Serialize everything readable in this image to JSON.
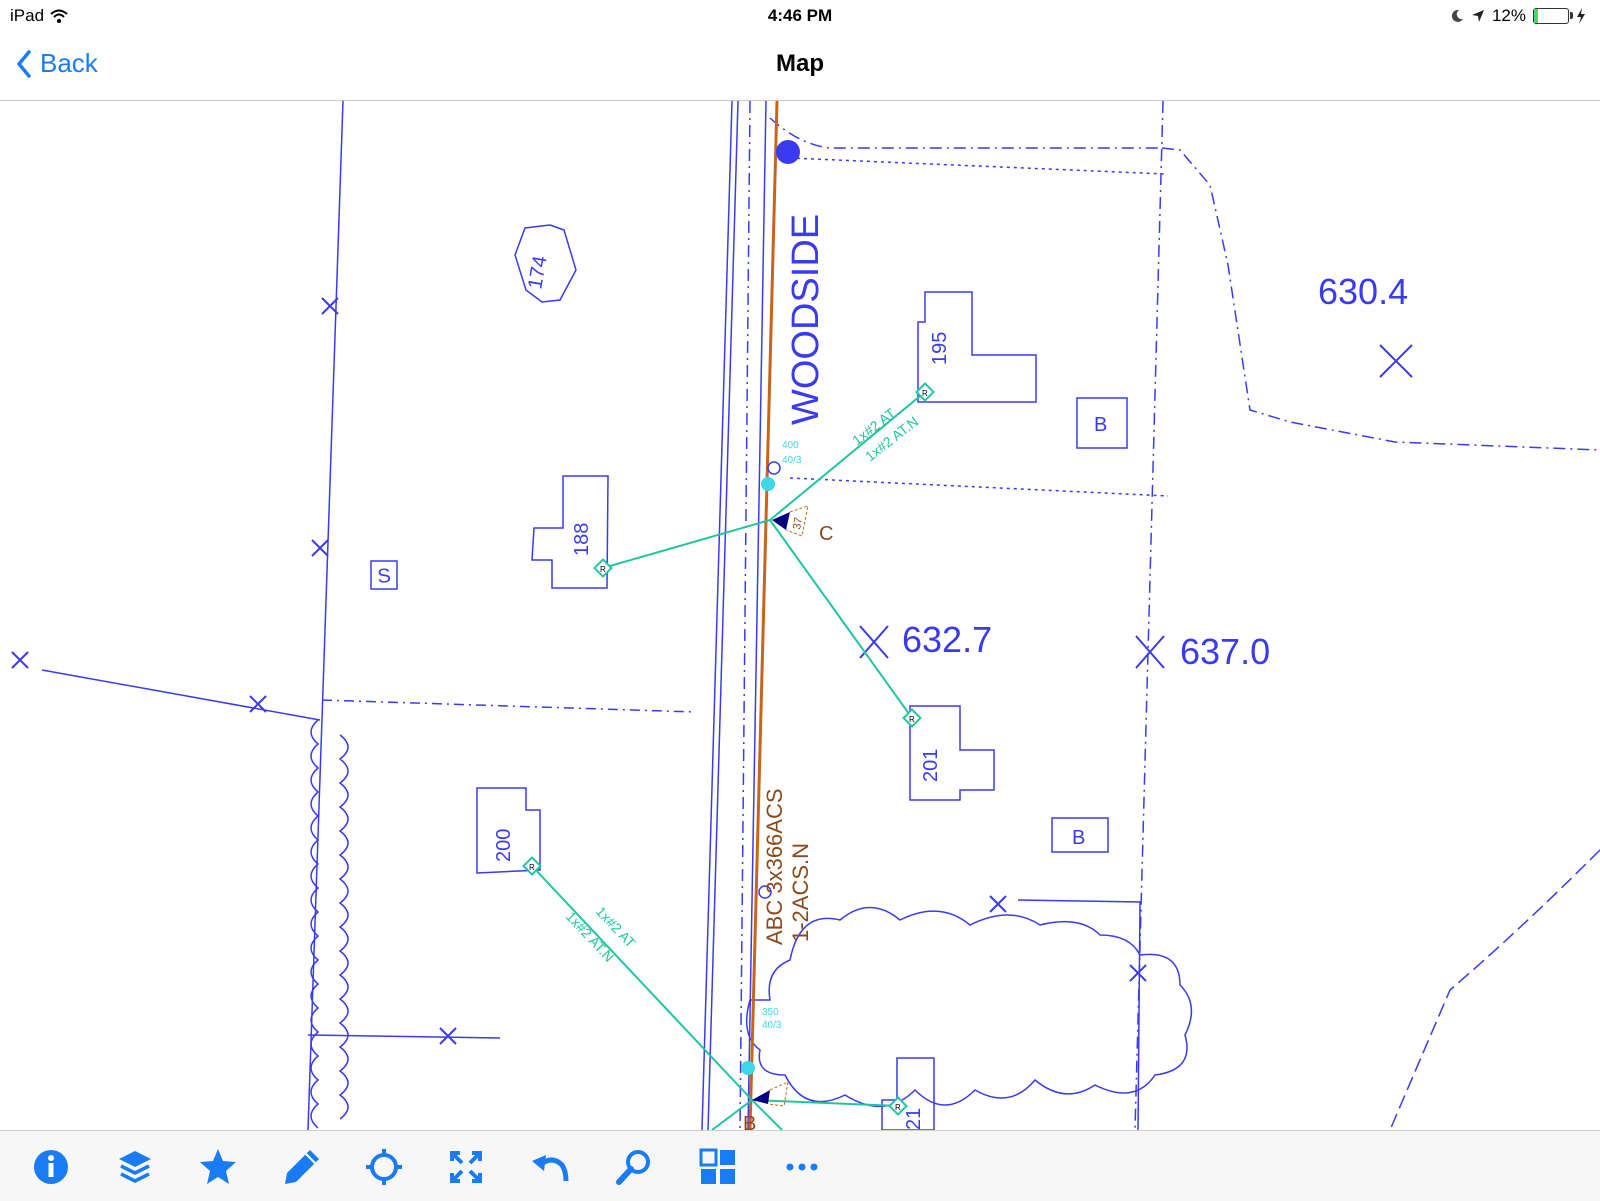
{
  "status_bar": {
    "device": "iPad",
    "time": "4:46 PM",
    "battery": "12%",
    "battery_level": 0.12
  },
  "nav": {
    "back_label": "Back",
    "title": "Map"
  },
  "map": {
    "street_name": "WOODSIDE",
    "house_numbers": [
      "174",
      "195",
      "188",
      "201",
      "200",
      "21"
    ],
    "building_labels": [
      "B",
      "B",
      "S"
    ],
    "elevations": [
      "630.4",
      "632.7",
      "637.0"
    ],
    "pole_labels": [
      "C",
      "B"
    ],
    "conductor_label_1": "ABC 3x366ACS",
    "conductor_label_2": "1-2ACS.N",
    "service_labels": {
      "at": "1x#2 AT",
      "atn": "1x#2 AT.N"
    },
    "service_marker": "R",
    "small_labels": {
      "top_1": "400",
      "top_2": "40/3",
      "bot_1": "350",
      "bot_2": "40/3",
      "tag": "37"
    }
  },
  "toolbar": {
    "icons": [
      "info-icon",
      "layers-icon",
      "star-icon",
      "pencil-icon",
      "locate-icon",
      "fit-extent-icon",
      "undo-icon",
      "search-icon",
      "basemap-grid-icon",
      "more-icon"
    ]
  },
  "colors": {
    "accent": "#1a7cf5",
    "map_lines": "#3a3af0",
    "primary_line": "#c8651c",
    "service_line": "#22c4a0"
  }
}
